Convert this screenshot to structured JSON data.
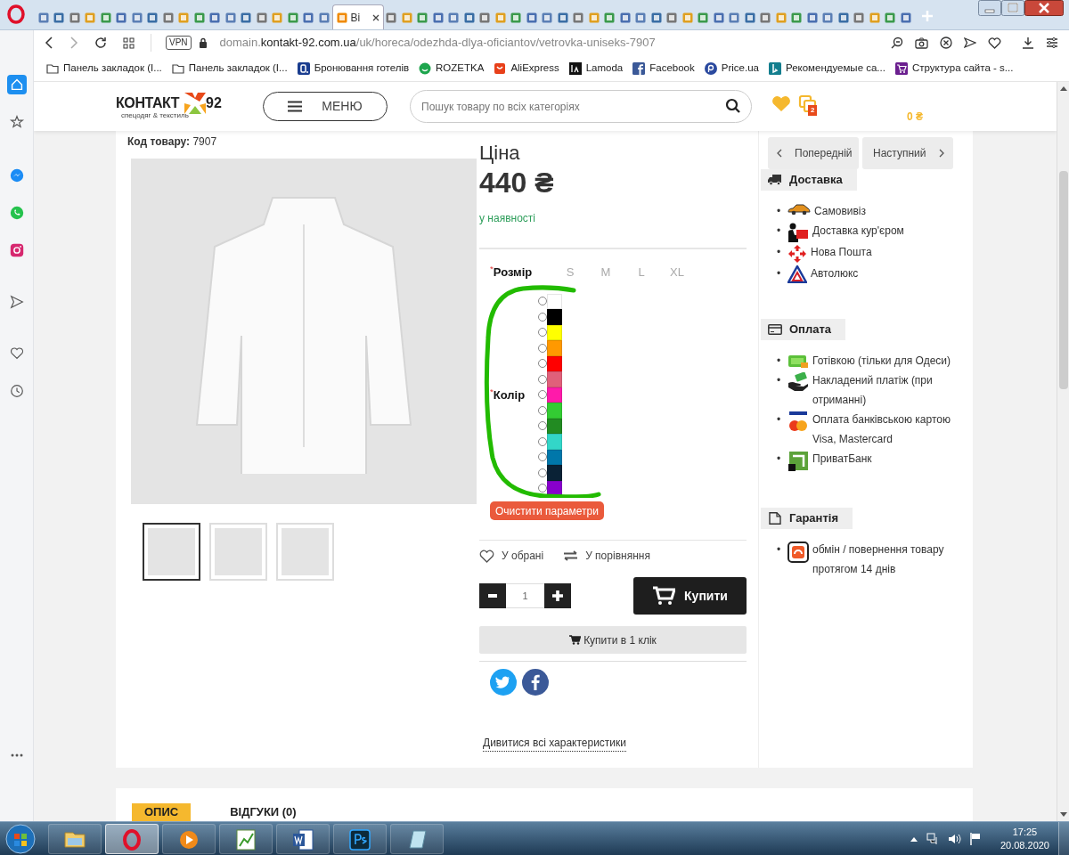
{
  "browser": {
    "tabs": [
      {
        "selected": false
      },
      {
        "selected": false
      },
      {
        "selected": false
      },
      {
        "selected": false
      },
      {
        "selected": false
      },
      {
        "selected": false
      },
      {
        "selected": false
      },
      {
        "selected": false
      },
      {
        "selected": false
      },
      {
        "selected": false
      },
      {
        "selected": false
      },
      {
        "selected": false
      },
      {
        "selected": false
      },
      {
        "selected": false
      },
      {
        "selected": false
      },
      {
        "selected": false
      },
      {
        "selected": false
      },
      {
        "selected": false
      },
      {
        "selected": false
      },
      {
        "title": "Ві",
        "selected": true
      },
      {
        "selected": false
      },
      {
        "selected": false
      },
      {
        "selected": false
      },
      {
        "selected": false
      },
      {
        "selected": false
      },
      {
        "selected": false
      },
      {
        "selected": false
      },
      {
        "selected": false
      },
      {
        "selected": false
      },
      {
        "selected": false
      },
      {
        "selected": false
      },
      {
        "selected": false
      },
      {
        "selected": false
      },
      {
        "selected": false
      },
      {
        "selected": false
      },
      {
        "selected": false
      },
      {
        "selected": false
      },
      {
        "selected": false
      },
      {
        "selected": false
      },
      {
        "selected": false
      },
      {
        "selected": false
      },
      {
        "selected": false
      },
      {
        "selected": false
      },
      {
        "selected": false
      },
      {
        "selected": false
      },
      {
        "selected": false
      },
      {
        "selected": false
      },
      {
        "selected": false
      },
      {
        "selected": false
      },
      {
        "selected": false
      },
      {
        "selected": false
      },
      {
        "selected": false
      },
      {
        "selected": false
      },
      {
        "selected": false
      }
    ],
    "address_bar": {
      "vpn_badge": "VPN",
      "url": {
        "subdomain": "domain.",
        "host": "kontakt-92.com.ua",
        "path": "/uk/horeca/odezhda-dlya-oficiantov/vetrovka-uniseks-7907"
      }
    },
    "bookmarks": [
      {
        "kind": "folder",
        "label": "Панель закладок (І..."
      },
      {
        "kind": "folder",
        "label": "Панель закладок (І..."
      },
      {
        "kind": "booking",
        "label": "Бронювання готелів"
      },
      {
        "kind": "rozetka",
        "label": "ROZETKA"
      },
      {
        "kind": "aliexpress",
        "label": "AliExpress"
      },
      {
        "kind": "lamoda",
        "label": "Lamoda"
      },
      {
        "kind": "facebook",
        "label": "Facebook"
      },
      {
        "kind": "price",
        "label": "Price.ua"
      },
      {
        "kind": "bing",
        "label": "Рекомендуемые са..."
      },
      {
        "kind": "cart",
        "label": "Структура сайта - s..."
      }
    ]
  },
  "opera_sidebar": [
    {
      "kind": "home",
      "selected": true
    },
    {
      "kind": "star",
      "selected": false
    },
    {
      "kind": "messenger",
      "selected": false
    },
    {
      "kind": "whatsapp",
      "selected": false
    },
    {
      "kind": "instagram",
      "selected": false
    },
    {
      "kind": "send",
      "selected": false
    },
    {
      "kind": "heart",
      "selected": false
    },
    {
      "kind": "history",
      "selected": false
    }
  ],
  "site_header": {
    "logo": {
      "name": "КОНТАКТ",
      "number": "92",
      "tagline": "спецодяг & текстиль"
    },
    "menu_button": "МЕНЮ",
    "search": {
      "placeholder": "Пошук товару по всіх категоріях"
    },
    "compare_count": "2",
    "cart_total": "0 ₴"
  },
  "product": {
    "code_label": "Код товару:",
    "code": "7907",
    "thumbnails": [
      {
        "selected": true
      },
      {
        "selected": false
      },
      {
        "selected": false
      }
    ],
    "price_label": "Ціна",
    "price": "440 ₴",
    "availability": "у наявності",
    "size": {
      "required_mark": "*",
      "label": "Розмір",
      "options": [
        {
          "label": "S",
          "selected": false
        },
        {
          "label": "M",
          "selected": false
        },
        {
          "label": "L",
          "selected": false
        },
        {
          "label": "XL",
          "selected": false
        }
      ]
    },
    "color": {
      "required_mark": "*",
      "label": "Колір",
      "options": [
        {
          "color": "#ffffff",
          "selected": false
        },
        {
          "color": "#000000",
          "selected": false
        },
        {
          "color": "#ffff00",
          "selected": false
        },
        {
          "color": "#ff9900",
          "selected": false
        },
        {
          "color": "#ff0000",
          "selected": false
        },
        {
          "color": "#e0607a",
          "selected": false
        },
        {
          "color": "#ff1aaa",
          "selected": false
        },
        {
          "color": "#33cc33",
          "selected": false
        },
        {
          "color": "#228b22",
          "selected": false
        },
        {
          "color": "#33d6c8",
          "selected": false
        },
        {
          "color": "#0077aa",
          "selected": false
        },
        {
          "color": "#0a2236",
          "selected": false
        },
        {
          "color": "#8800cc",
          "selected": false
        }
      ]
    },
    "clear_button": "Очистити параметри",
    "wishlist": "У обрані",
    "compare": "У порівняння",
    "quantity": "1",
    "buy_button": "Купити",
    "one_click_button": "Купити в 1 клік",
    "all_specs_link": "Дивитися всі характеристики"
  },
  "sidebar": {
    "prev": "Попередній",
    "next": "Наступний",
    "sections": [
      {
        "kind": "truck",
        "title": "Доставка",
        "items": [
          {
            "marker": "•",
            "kind": "car",
            "label": "Самовивіз"
          },
          {
            "marker": "•",
            "kind": "courier",
            "label": "Доставка кур'єром"
          },
          {
            "marker": "•",
            "kind": "arrows",
            "label": "Нова Пошта"
          },
          {
            "marker": "•",
            "kind": "triangle",
            "label": "Автолюкс"
          }
        ]
      },
      {
        "kind": "card",
        "title": "Оплата",
        "items": [
          {
            "marker": "•",
            "kind": "cash",
            "label": "Готівкою (тільки для Одеси)"
          },
          {
            "marker": "•",
            "kind": "hand",
            "label": "Накладений платіж (при отриманні)"
          },
          {
            "marker": "•",
            "kind": "visa",
            "label": "Оплата банківською картою Visa, Mastercard"
          },
          {
            "marker": "•",
            "kind": "bank",
            "label": "ПриватБанк"
          }
        ]
      },
      {
        "kind": "document",
        "title": "Гарантія",
        "items": [
          {
            "marker": "•",
            "kind": "exchange",
            "label": "обмін / повернення товару протягом 14 днів"
          }
        ]
      }
    ]
  },
  "bottom_tabs": [
    {
      "label": "ОПИС",
      "selected": true
    },
    {
      "label": "ВІДГУКИ (0)",
      "selected": false
    }
  ],
  "taskbar": {
    "apps": [
      {
        "kind": "explorer",
        "selected": false
      },
      {
        "kind": "opera",
        "selected": true
      },
      {
        "kind": "media",
        "selected": false
      },
      {
        "kind": "chart",
        "selected": false
      },
      {
        "kind": "word",
        "selected": false
      },
      {
        "kind": "photoshop",
        "selected": false
      },
      {
        "kind": "notepad",
        "selected": false
      }
    ],
    "time": "17:25",
    "date": "20.08.2020"
  }
}
